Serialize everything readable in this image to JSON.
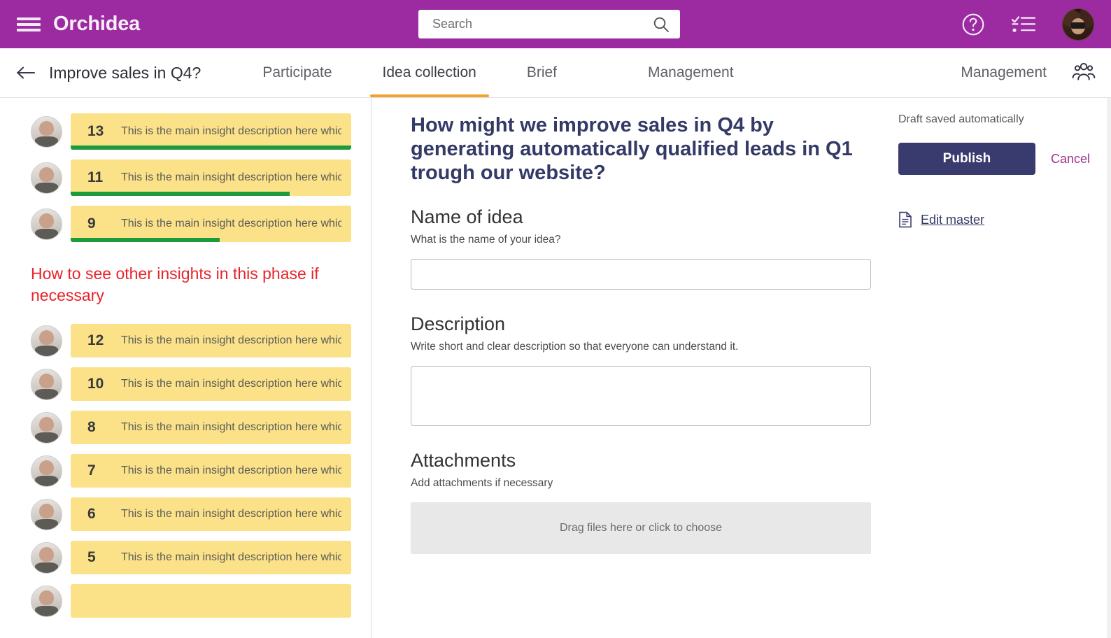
{
  "topbar": {
    "brand": "Orchidea",
    "menu_icon": "hamburger-icon",
    "search": {
      "value": "",
      "placeholder": "Search",
      "icon": "search-icon"
    },
    "help_icon": "help-circle-icon",
    "tasks_icon": "checklist-icon",
    "avatar": "user-avatar",
    "bg_color": "#9C2AA0"
  },
  "tabbar": {
    "back_icon": "arrow-left-icon",
    "page_title": "Improve sales in Q4?",
    "tabs": [
      {
        "label": "Participate",
        "active": false
      },
      {
        "label": "Idea collection",
        "active": true
      },
      {
        "label": "Brief",
        "active": false
      },
      {
        "label": "Management",
        "active": false
      }
    ],
    "right_label": "Management",
    "people_icon": "people-group-icon",
    "active_underline_color": "#F0A32B"
  },
  "insights_panel": {
    "top_items": [
      {
        "number": "13",
        "text": "This is the main insight description here which..",
        "bar_percent": 100
      },
      {
        "number": "11",
        "text": "This is the main insight description here which..",
        "bar_percent": 78
      },
      {
        "number": "9",
        "text": "This is the main insight description here which..",
        "bar_percent": 53
      }
    ],
    "note": "How to see other insights in this phase if necessary",
    "note_color": "#E8242A",
    "bottom_items": [
      {
        "number": "12",
        "text": "This is the main insight description here which can"
      },
      {
        "number": "10",
        "text": "This is the main insight description here which can"
      },
      {
        "number": "8",
        "text": "This is the main insight description here which can"
      },
      {
        "number": "7",
        "text": "This is the main insight description here which can"
      },
      {
        "number": "6",
        "text": "This is the main insight description here which can"
      },
      {
        "number": "5",
        "text": "This is the main insight description here which can"
      }
    ],
    "card_color": "#FBE288",
    "bar_color": "#1D9B3C"
  },
  "idea_form": {
    "heading": "How might we improve sales in Q4 by generating automatically qualified leads in Q1 trough our website?",
    "heading_color": "#343A66",
    "name_section": {
      "label": "Name of idea",
      "hint": "What is the name of your idea?",
      "value": "",
      "placeholder": ""
    },
    "description_section": {
      "label": "Description",
      "hint": "Write short and clear description so that everyone can understand it.",
      "value": "",
      "placeholder": ""
    },
    "attachments_section": {
      "label": "Attachments",
      "hint": "Add attachments if necessary",
      "dropzone_text": "Drag files here or click to choose"
    }
  },
  "actions": {
    "draft_status": "Draft saved automatically",
    "publish_label": "Publish",
    "publish_color": "#393A6E",
    "cancel_label": "Cancel",
    "cancel_color": "#A0338F",
    "edit_master_label": "Edit master",
    "edit_master_icon": "document-icon"
  }
}
